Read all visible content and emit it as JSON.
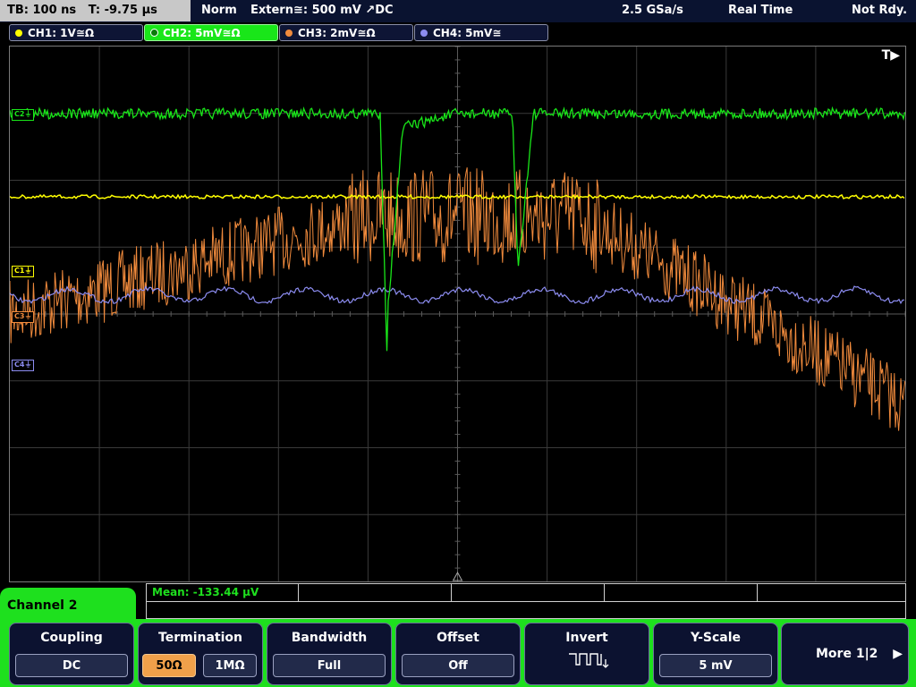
{
  "status_bar": {
    "timebase": "TB: 100 ns",
    "trigger_time": "T: -9.75 µs",
    "mode": "Norm",
    "trigger_source": "Extern≅: 500 mV ↗DC",
    "sample_rate": "2.5 GSa/s",
    "acq_mode": "Real Time",
    "state": "Not Rdy."
  },
  "channel_tabs": [
    {
      "label": "CH1: 1V≅Ω",
      "color": "#ffff00"
    },
    {
      "label": "CH2: 5mV≅Ω",
      "color": "#19e619"
    },
    {
      "label": "CH3: 2mV≅Ω",
      "color": "#f08a3c"
    },
    {
      "label": "CH4: 5mV≅",
      "color": "#8c8cf0"
    }
  ],
  "trigger_marker": "T▶",
  "channel_markers": {
    "c1": "C1⏚",
    "c2": "C2⏚",
    "c3": "C3⏚",
    "c4": "C4⏚"
  },
  "colors": {
    "ch1": "#ffff00",
    "ch2": "#19e619",
    "ch3": "#f08a3c",
    "ch4": "#8c8cf0",
    "grid": "#3a3a3a"
  },
  "panel": {
    "title": "Channel 2"
  },
  "measurement": {
    "mean": "Mean: -133.44 µV"
  },
  "softkeys": {
    "coupling": {
      "label": "Coupling",
      "value": "DC"
    },
    "termination": {
      "label": "Termination",
      "value_50": "50Ω",
      "value_1m": "1MΩ"
    },
    "bandwidth": {
      "label": "Bandwidth",
      "value": "Full"
    },
    "offset": {
      "label": "Offset",
      "value": "Off"
    },
    "invert": {
      "label": "Invert",
      "icon": "pulse-train-icon"
    },
    "yscale": {
      "label": "Y-Scale",
      "value": "5 mV"
    },
    "more": {
      "label": "More 1|2"
    }
  }
}
